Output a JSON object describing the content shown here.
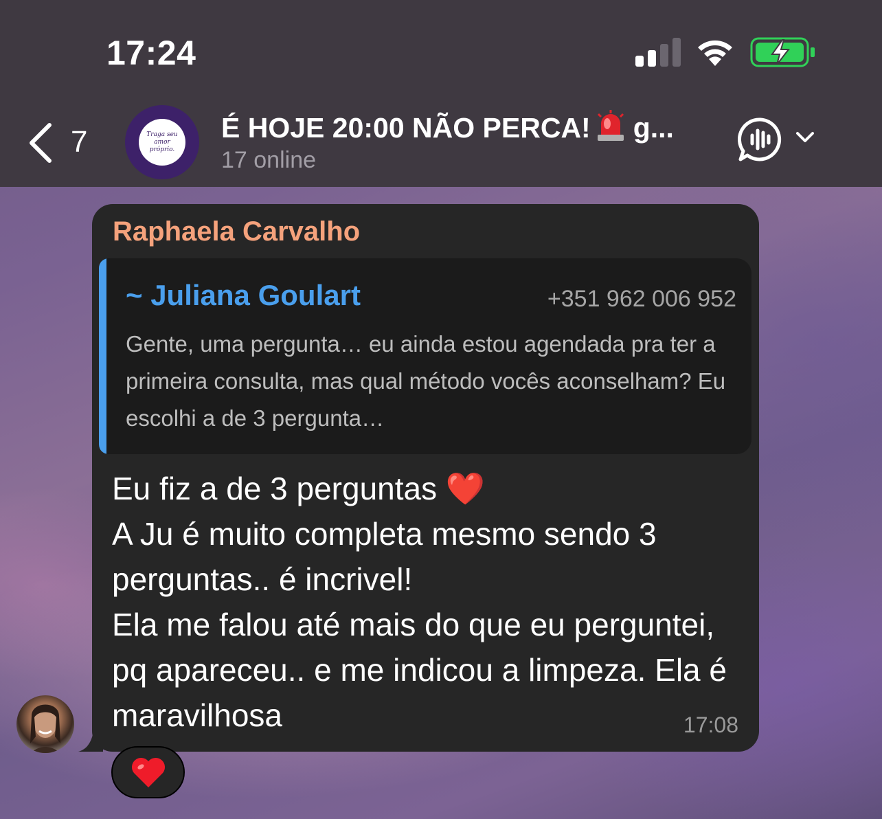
{
  "status_bar": {
    "time": "17:24",
    "signal_bars_active": 2,
    "signal_bars_total": 4,
    "battery_charging": true,
    "battery_color": "#30d158"
  },
  "header": {
    "back_icon": "chevron-left-icon",
    "back_count": "7",
    "group_avatar_text": "Traga seu amor próprio.",
    "title": "É HOJE 20:00 NÃO PERCA!",
    "title_emoji": "siren-icon",
    "title_suffix": "g...",
    "subtitle": "17 online",
    "voice_chat_icon": "voice-chat-icon",
    "dropdown_icon": "chevron-down-icon"
  },
  "message": {
    "sender": "Raphaela Carvalho",
    "sender_color": "#f5a27c",
    "reply": {
      "name": "~ Juliana Goulart",
      "phone": "+351 962 006 952",
      "text": "Gente, uma pergunta… eu ainda estou agendada pra ter a primeira consulta, mas qual método vocês aconselham? Eu escolhi a de 3 pergunta…",
      "accent_color": "#4a9fed"
    },
    "text": "Eu fiz a de 3 perguntas ❤️\nA Ju é muito completa mesmo sendo 3 perguntas.. é incrivel!\nEla me falou até mais do que eu perguntei, pq apareceu.. e me indicou a limpeza. Ela é maravilhosa",
    "time": "17:08",
    "reaction": "❤️"
  }
}
